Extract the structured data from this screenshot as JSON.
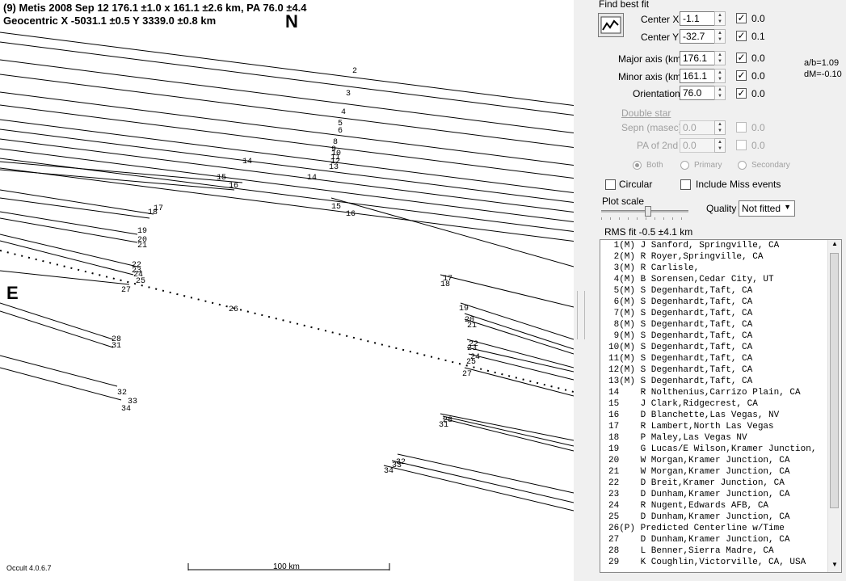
{
  "plot": {
    "title_line1": "(9) Metis  2008 Sep 12  176.1 ±1.0 x 161.1 ±2.6 km, PA 76.0 ±4.4",
    "title_line2": "Geocentric  X  -5031.1 ±0.5   Y 3339.0 ±0.8 km",
    "north_label": "N",
    "east_label": "E",
    "version": "Occult 4.0.6.7",
    "scale_label": "100 km",
    "chord_labels": [
      "2",
      "3",
      "4",
      "5",
      "6",
      "8",
      "9",
      "10",
      "11",
      "12",
      "13",
      "14",
      "15",
      "16",
      "14",
      "15",
      "16",
      "17",
      "18",
      "19",
      "20",
      "21",
      "22",
      "23",
      "24",
      "25",
      "27",
      "26",
      "28",
      "31",
      "32",
      "33",
      "34",
      "17",
      "18",
      "19",
      "20",
      "21",
      "22",
      "23",
      "24",
      "25",
      "27",
      "28",
      "31",
      "32",
      "33",
      "34"
    ]
  },
  "panel": {
    "find_best_fit": "Find best fit",
    "fields": [
      {
        "label": "Center X",
        "value": "-1.1",
        "checked": true,
        "sigma": "0.0"
      },
      {
        "label": "Center Y",
        "value": "-32.7",
        "checked": true,
        "sigma": "0.1"
      },
      {
        "label": "Major axis (km)",
        "value": "176.1",
        "checked": true,
        "sigma": "0.0"
      },
      {
        "label": "Minor axis (km)",
        "value": "161.1",
        "checked": true,
        "sigma": "0.0"
      },
      {
        "label": "Orientation",
        "value": "76.0",
        "checked": true,
        "sigma": "0.0"
      }
    ],
    "ratio_ab": "a/b=1.09",
    "dm": "dM=-0.10",
    "double_star": "Double star",
    "sepn": {
      "label": "Sepn (masec)",
      "value": "0.0",
      "sigma": "0.0"
    },
    "pa2": {
      "label": "PA of 2nd",
      "value": "0.0",
      "sigma": "0.0"
    },
    "radio_both": "Both",
    "radio_primary": "Primary",
    "radio_secondary": "Secondary",
    "circular": "Circular",
    "include_miss": "Include Miss events",
    "plot_scale": "Plot scale",
    "quality_label": "Quality",
    "quality_value": "Not fitted",
    "rms_fit": "RMS fit -0.5 ±4.1 km",
    "observers": [
      " 1(M) J Sanford, Springville, CA",
      " 2(M) R Royer,Springville, CA",
      " 3(M) R Carlisle,",
      " 4(M) B Sorensen,Cedar City, UT",
      " 5(M) S Degenhardt,Taft, CA",
      " 6(M) S Degenhardt,Taft, CA",
      " 7(M) S Degenhardt,Taft, CA",
      " 8(M) S Degenhardt,Taft, CA",
      " 9(M) S Degenhardt,Taft, CA",
      "10(M) S Degenhardt,Taft, CA",
      "11(M) S Degenhardt,Taft, CA",
      "12(M) S Degenhardt,Taft, CA",
      "13(M) S Degenhardt,Taft, CA",
      "14    R Nolthenius,Carrizo Plain, CA",
      "15    J Clark,Ridgecrest, CA",
      "16    D Blanchette,Las Vegas, NV",
      "17    R Lambert,North Las Vegas",
      "18    P Maley,Las Vegas NV",
      "19    G Lucas/E Wilson,Kramer Junction,",
      "20    W Morgan,Kramer Junction, CA",
      "21    W Morgan,Kramer Junction, CA",
      "22    D Breit,Kramer Junction, CA",
      "23    D Dunham,Kramer Junction, CA",
      "24    R Nugent,Edwards AFB, CA",
      "25    D Dunham,Kramer Junction, CA",
      "26(P) Predicted Centerline w/Time",
      "27    D Dunham,Kramer Junction, CA",
      "28    L Benner,Sierra Madre, CA",
      "29    K Coughlin,Victorville, CA, USA"
    ]
  }
}
